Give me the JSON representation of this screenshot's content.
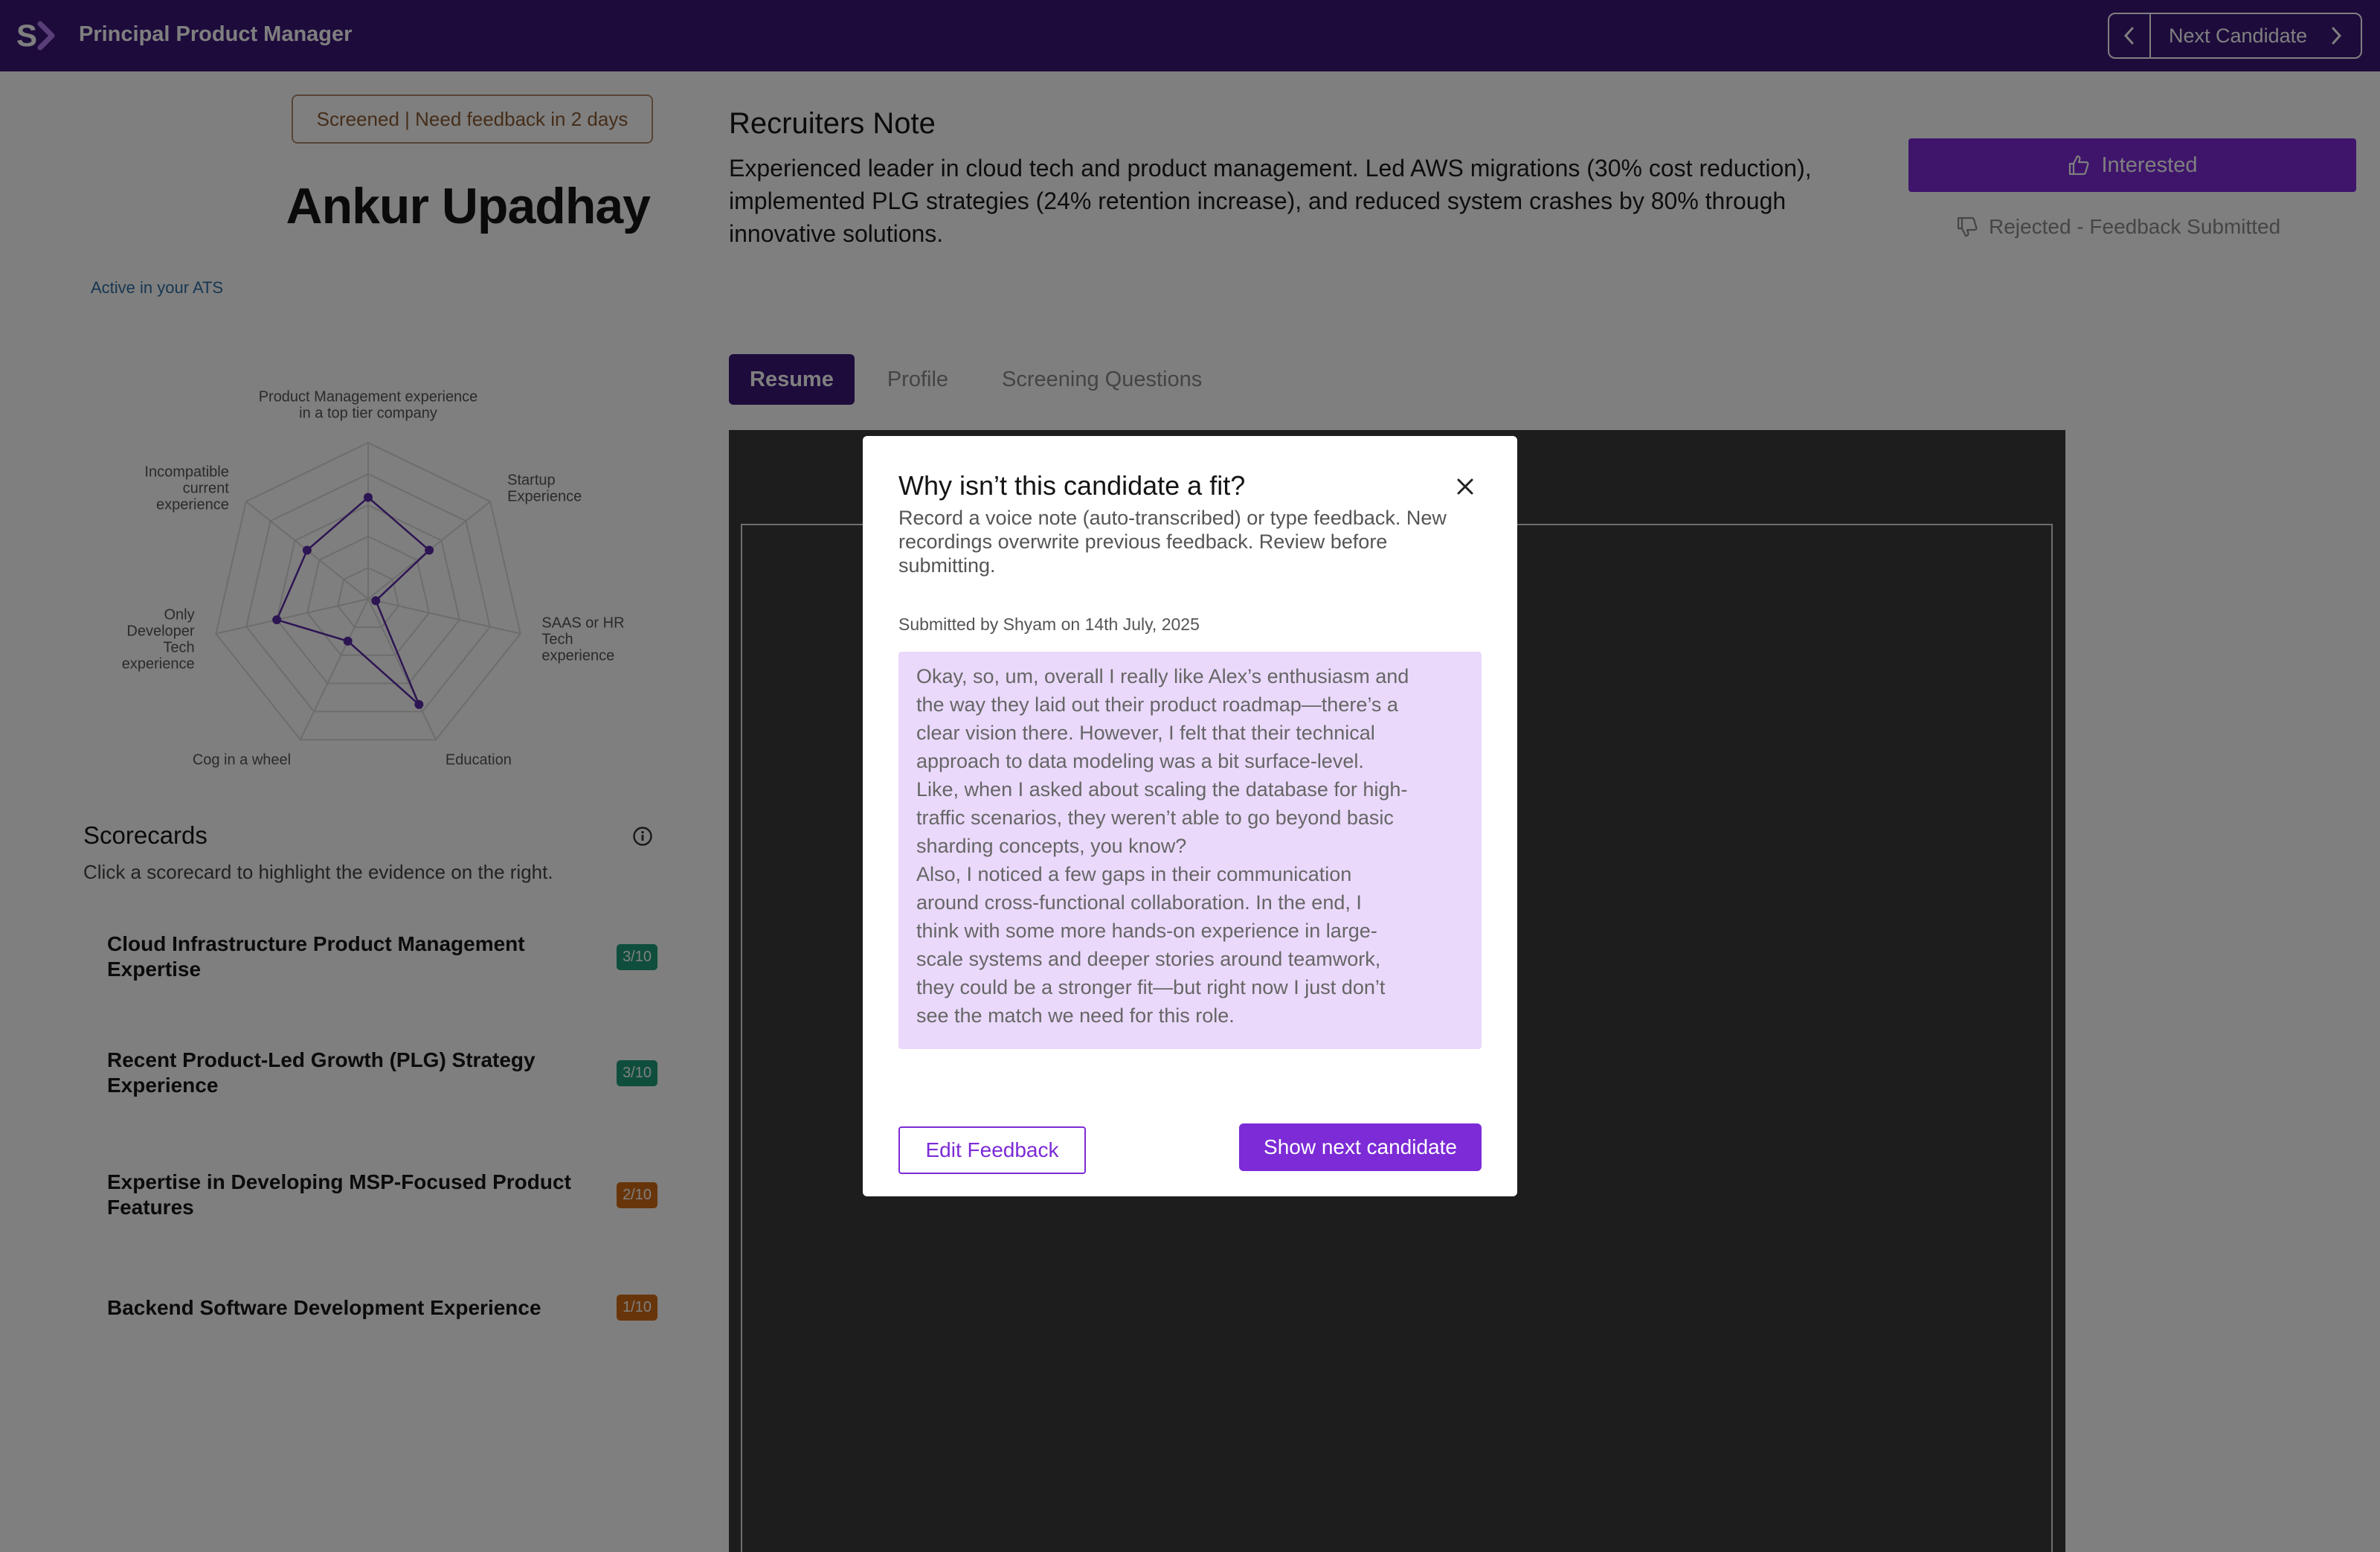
{
  "header": {
    "logo_letter": "S",
    "job_title": "Principal Product Manager",
    "next_candidate_label": "Next Candidate"
  },
  "candidate": {
    "status": "Screened | Need feedback in 2 days",
    "name": "Ankur Upadhay",
    "ats_status": "Active in your ATS"
  },
  "radar": {
    "axes": [
      {
        "label_lines": [
          "Product Management experience",
          "in a top tier company"
        ],
        "value": 0.65
      },
      {
        "label_lines": [
          "Startup",
          "Experience"
        ],
        "value": 0.5
      },
      {
        "label_lines": [
          "SAAS or HR",
          "Tech",
          "experience"
        ],
        "value": 0.05
      },
      {
        "label_lines": [
          "Education"
        ],
        "value": 0.75
      },
      {
        "label_lines": [
          "Cog in a wheel"
        ],
        "value": 0.3
      },
      {
        "label_lines": [
          "Only",
          "Developer",
          "Tech",
          "experience"
        ],
        "value": 0.6
      },
      {
        "label_lines": [
          "Incompatible",
          "current",
          "experience"
        ],
        "value": 0.5
      }
    ],
    "rings": 5,
    "line_color": "#5b2aa6",
    "grid_color": "#dadada"
  },
  "scorecards": {
    "title": "Scorecards",
    "subtitle": "Click a scorecard to highlight the evidence on the right.",
    "items": [
      {
        "label": "Cloud Infrastructure Product Management Expertise",
        "score": "3/10",
        "tone": "green"
      },
      {
        "label": "Recent Product-Led Growth (PLG) Strategy Experience",
        "score": "3/10",
        "tone": "green"
      },
      {
        "label": "Expertise in Developing MSP-Focused Product Features",
        "score": "2/10",
        "tone": "orange"
      },
      {
        "label": "Backend Software Development Experience",
        "score": "1/10",
        "tone": "orange"
      }
    ]
  },
  "recruiter": {
    "title": "Recruiters Note",
    "note": "Experienced leader in cloud tech and product management. Led AWS migrations (30% cost reduction), implemented PLG strategies (24% retention increase), and reduced system crashes by 80% through innovative solutions."
  },
  "actions": {
    "interested": "Interested",
    "rejected": "Rejected - Feedback Submitted"
  },
  "tabs": [
    "Resume",
    "Profile",
    "Screening Questions"
  ],
  "modal": {
    "title": "Why isn’t this candidate a fit?",
    "description": "Record a voice note (auto-transcribed) or type feedback. New recordings overwrite previous feedback. Review before submitting.",
    "meta": "Submitted by Shyam on 14th July, 2025",
    "feedback_lines": [
      "Okay, so, um, overall I really like Alex’s enthusiasm and",
      "the way they laid out their product roadmap—there’s a",
      "clear vision there. However, I felt that their technical",
      "approach to data modeling was a bit surface-level.",
      "Like, when I asked about scaling the database for high-",
      "traffic scenarios, they weren’t able to go beyond basic",
      "sharding concepts, you know?",
      "Also, I noticed a few gaps in their communication",
      "around cross-functional collaboration. In the end, I",
      "think with some more hands-on experience in large-",
      "scale systems and deeper stories around teamwork,",
      "they could be a stronger fit—but right now I just don’t",
      "see the match we need for this role."
    ],
    "edit_label": "Edit Feedback",
    "next_label": "Show next candidate"
  },
  "colors": {
    "brand": "#3a1778",
    "accent": "#7c2bd6",
    "feedback_bg": "#ead9fb"
  }
}
